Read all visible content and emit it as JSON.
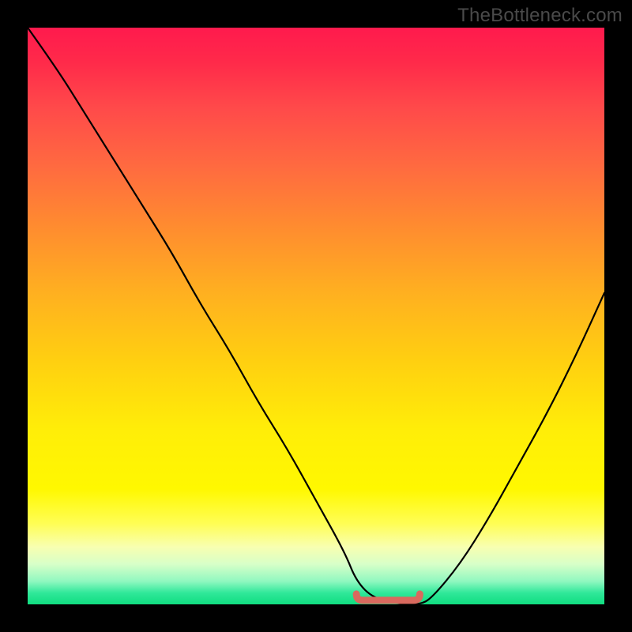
{
  "watermark": "TheBottleneck.com",
  "chart_data": {
    "type": "line",
    "title": "",
    "xlabel": "",
    "ylabel": "",
    "xlim": [
      0,
      100
    ],
    "ylim": [
      0,
      100
    ],
    "grid": false,
    "legend": false,
    "series": [
      {
        "name": "bottleneck-curve",
        "color": "#000000",
        "x": [
          0,
          5,
          10,
          15,
          20,
          25,
          30,
          35,
          40,
          45,
          50,
          55,
          57,
          60,
          65,
          68,
          70,
          75,
          80,
          85,
          90,
          95,
          100
        ],
        "y": [
          100,
          93,
          85,
          77,
          69,
          61,
          52,
          44,
          35,
          27,
          18,
          9,
          4,
          1,
          0,
          0,
          1,
          7,
          15,
          24,
          33,
          43,
          54
        ]
      },
      {
        "name": "optimal-range-marker",
        "color": "#d9695e",
        "x": [
          57,
          68
        ],
        "y": [
          0.7,
          0.7
        ]
      }
    ],
    "annotations": []
  }
}
